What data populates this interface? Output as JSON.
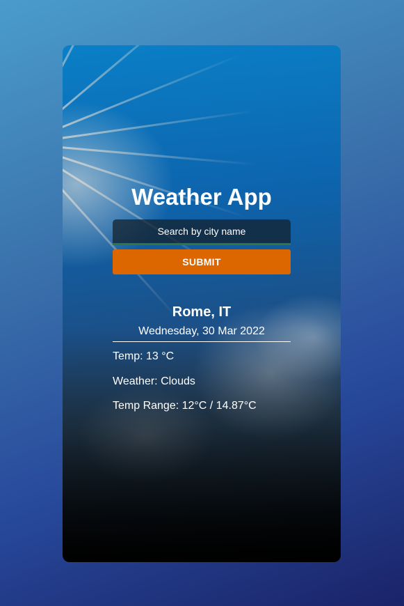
{
  "app": {
    "title": "Weather App"
  },
  "search": {
    "placeholder": "Search by city name",
    "value": "",
    "submit_label": "SUBMIT"
  },
  "result": {
    "location": "Rome, IT",
    "date": "Wednesday, 30 Mar 2022",
    "temp": "Temp: 13 °C",
    "weather": "Weather: Clouds",
    "temp_range": "Temp Range: 12°C / 14.87°C"
  },
  "colors": {
    "submit_button": "#dc6600",
    "input_underline": "#2c7a43",
    "text": "#ffffff"
  }
}
